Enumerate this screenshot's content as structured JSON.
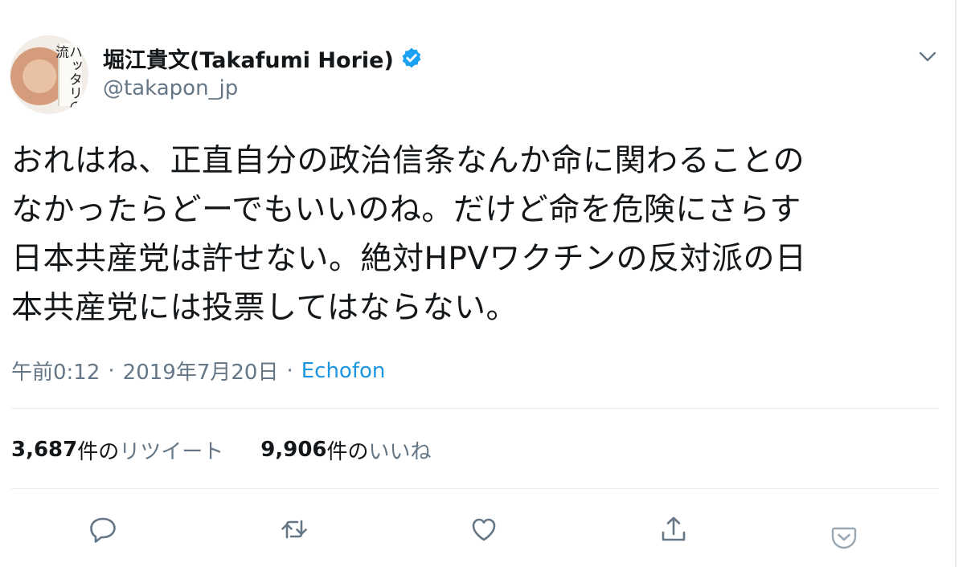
{
  "user": {
    "display_name": "堀江貴文(Takafumi Horie)",
    "handle": "@takapon_jp",
    "avatar_book_text": "ハッタリの流"
  },
  "tweet": {
    "lines": [
      "おれはね、正直自分の政治信条なんか命に関わることの",
      "なかったらどーでもいいのね。だけど命を危険にさらす",
      "日本共産党は許せない。絶対HPVワクチンの反対派の日",
      "本共産党には投票してはならない。"
    ]
  },
  "meta": {
    "time": "午前0:12",
    "date": "2019年7月20日",
    "separator": "·",
    "source": "Echofon"
  },
  "stats": {
    "retweets": {
      "count": "3,687",
      "unit": "件の",
      "label": "リツイート"
    },
    "likes": {
      "count": "9,906",
      "unit": "件の",
      "label": "いいね"
    }
  },
  "icons": {
    "verified": "verified-badge-icon",
    "caret": "chevron-down-icon",
    "reply": "reply-icon",
    "retweet": "retweet-icon",
    "like": "heart-icon",
    "share": "share-icon",
    "pocket": "pocket-icon"
  },
  "colors": {
    "text": "#14171a",
    "secondary": "#657786",
    "link": "#1b95e0",
    "verified": "#1da1f2",
    "divider": "#e6ecf0",
    "pocket": "#e0245e"
  }
}
